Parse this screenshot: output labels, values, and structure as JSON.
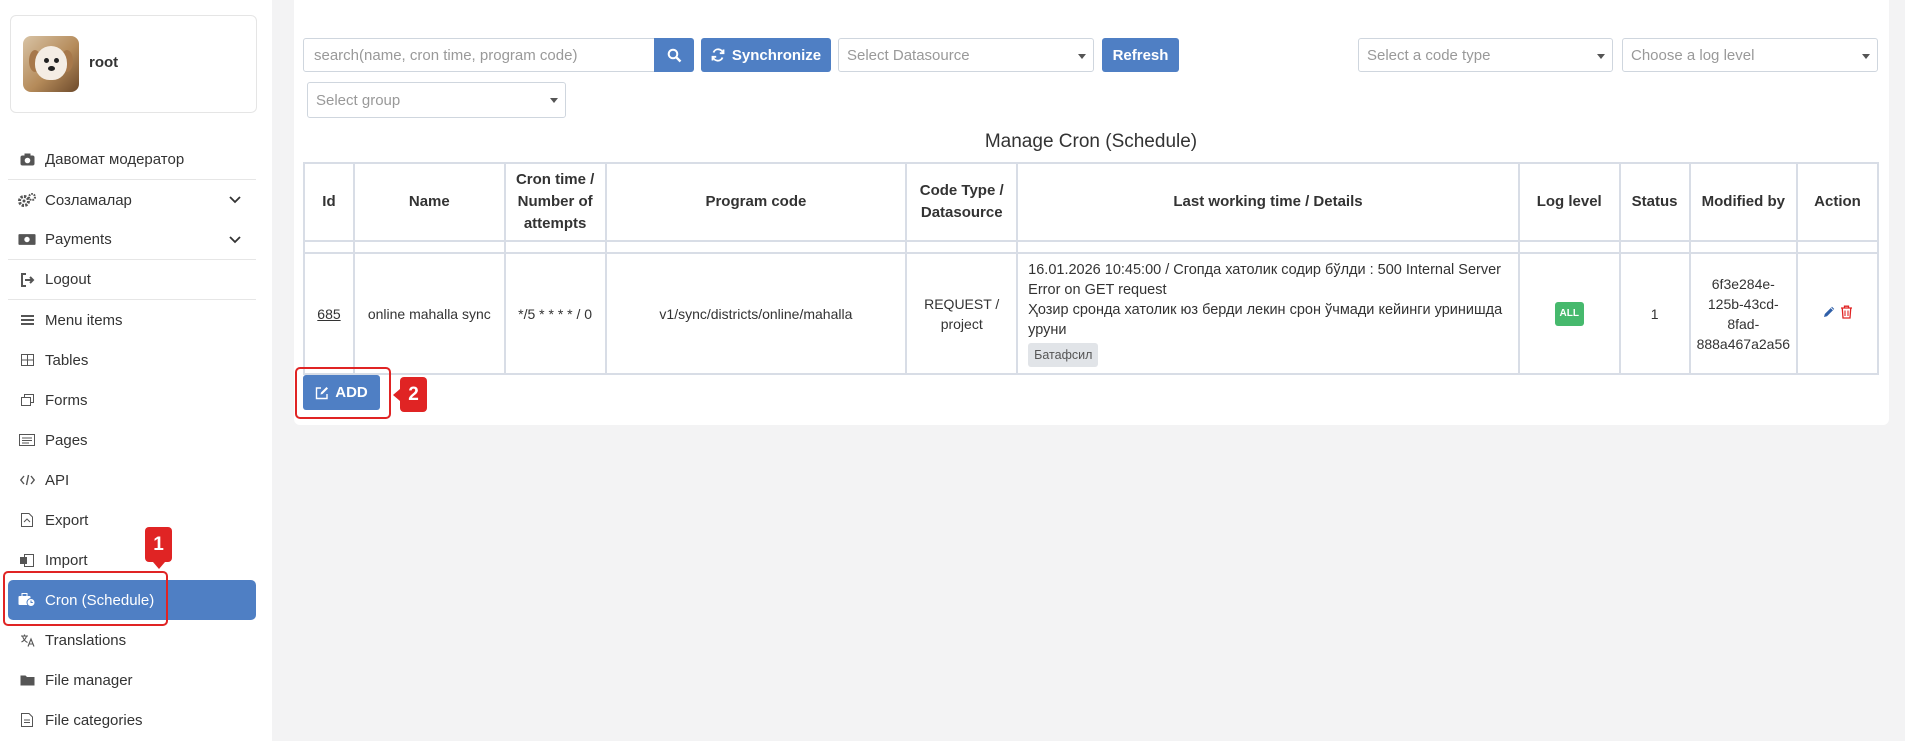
{
  "profile": {
    "name": "root"
  },
  "sidebar": {
    "items": [
      {
        "label": "Давомат модератор",
        "icon": "camera-icon"
      },
      {
        "label": "Созламалар",
        "icon": "gears-icon",
        "expandable": true
      },
      {
        "label": "Payments",
        "icon": "money-icon",
        "expandable": true
      },
      {
        "label": "Logout",
        "icon": "logout-icon"
      },
      {
        "label": "Menu items",
        "icon": "list-icon"
      },
      {
        "label": "Tables",
        "icon": "table-icon"
      },
      {
        "label": "Forms",
        "icon": "forms-icon"
      },
      {
        "label": "Pages",
        "icon": "pages-icon"
      },
      {
        "label": "API",
        "icon": "code-icon"
      },
      {
        "label": "Export",
        "icon": "file-export-icon"
      },
      {
        "label": "Import",
        "icon": "file-import-icon"
      },
      {
        "label": "Cron (Schedule)",
        "icon": "briefcase-clock-icon",
        "active": true
      },
      {
        "label": "Translations",
        "icon": "translate-icon"
      },
      {
        "label": "File manager",
        "icon": "folder-icon"
      },
      {
        "label": "File categories",
        "icon": "file-icon"
      }
    ]
  },
  "annotations": {
    "badge1": "1",
    "badge2": "2"
  },
  "toolbar": {
    "search_placeholder": "search(name, cron time, program code)",
    "sync_label": "Synchronize",
    "datasource_placeholder": "Select Datasource",
    "refresh_label": "Refresh",
    "code_type_placeholder": "Select a code type",
    "log_level_placeholder": "Choose a log level",
    "group_placeholder": "Select group"
  },
  "table": {
    "title": "Manage Cron (Schedule)",
    "headers": {
      "id": "Id",
      "name": "Name",
      "cron_1": "Cron time /",
      "cron_2": "Number of",
      "cron_3": "attempts",
      "program": "Program code",
      "code_1": "Code Type /",
      "code_2": "Datasource",
      "last": "Last working time / Details",
      "log": "Log level",
      "status": "Status",
      "modified": "Modified by",
      "action": "Action"
    },
    "rows": [
      {
        "id": "685",
        "name": "online mahalla sync",
        "cron": "*/5 * * * * / 0",
        "program": "v1/sync/districts/online/mahalla",
        "code_type": "REQUEST /",
        "datasource": "project",
        "detail_1": "16.01.2026 10:45:00 / Сгопда хатолик содир бўлди : 500 Internal Server Error on GET request",
        "detail_2": "Ҳозир сронда хатолик юз берди лекин срон ўчмади кейинги уринишда уруни",
        "more": "Батафсил",
        "log_level": "ALL",
        "status": "1",
        "modified_1": "6f3e284e-",
        "modified_2": "125b-43cd-",
        "modified_3": "8fad-",
        "modified_4": "888a467a2a56"
      }
    ]
  },
  "add_label": "ADD",
  "colors": {
    "primary": "#4f7fc4",
    "highlight": "#e02424",
    "log_badge": "#46b96d"
  }
}
